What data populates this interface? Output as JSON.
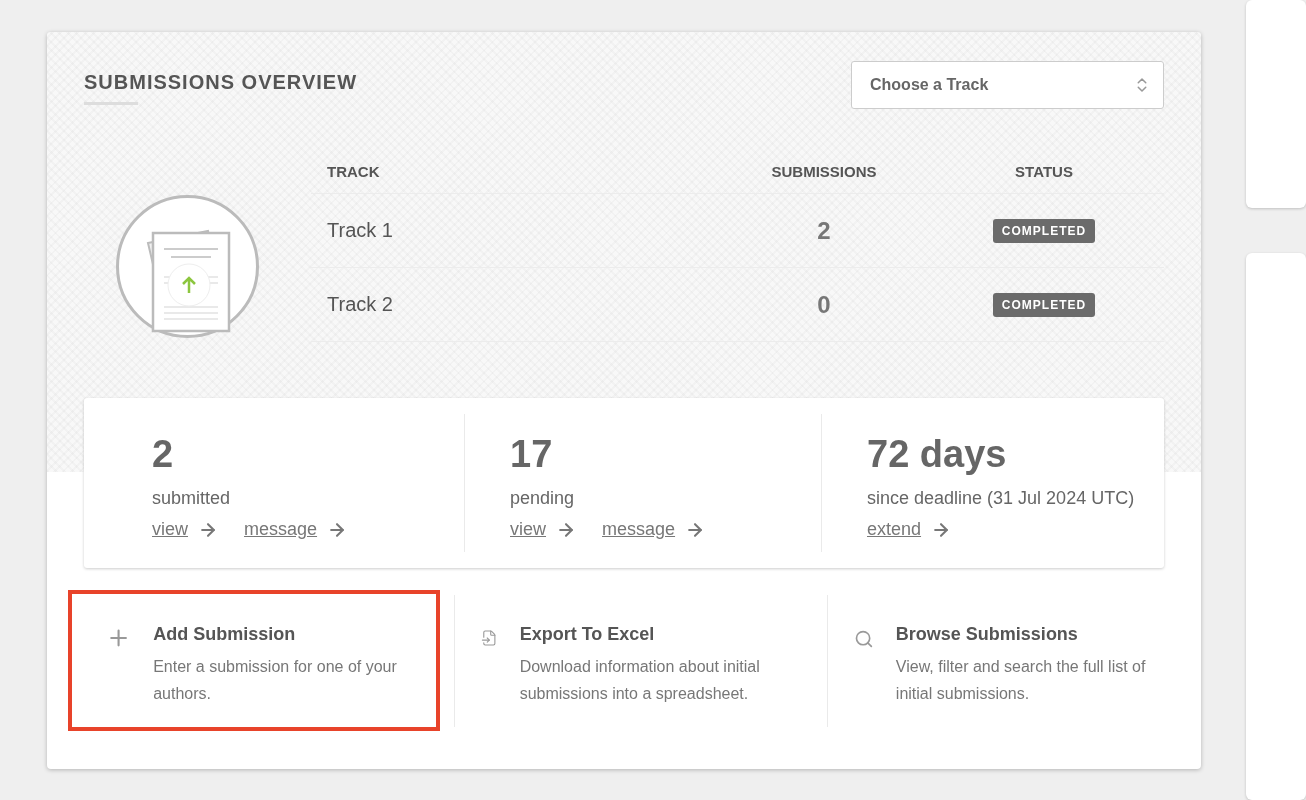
{
  "header": {
    "title": "SUBMISSIONS OVERVIEW",
    "track_select": {
      "value": "Choose a Track"
    }
  },
  "table": {
    "columns": [
      "TRACK",
      "SUBMISSIONS",
      "STATUS"
    ],
    "rows": [
      {
        "track": "Track 1",
        "submissions": "2",
        "status": "COMPLETED"
      },
      {
        "track": "Track 2",
        "submissions": "0",
        "status": "COMPLETED"
      }
    ]
  },
  "stats": [
    {
      "value": "2",
      "label": "submitted",
      "links": [
        "view",
        "message"
      ]
    },
    {
      "value": "17",
      "label": "pending",
      "links": [
        "view",
        "message"
      ]
    },
    {
      "value": "72 days",
      "label": "since deadline (31 Jul 2024 UTC)",
      "links": [
        "extend"
      ]
    }
  ],
  "actions": [
    {
      "kind": "add",
      "title": "Add Submission",
      "description": "Enter a submission for one of your authors.",
      "highlighted": true
    },
    {
      "kind": "export",
      "title": "Export To Excel",
      "description": "Download information about initial submissions into a spreadsheet.",
      "highlighted": false
    },
    {
      "kind": "search",
      "title": "Browse Submissions",
      "description": "View, filter and search the full list of initial submissions.",
      "highlighted": false
    }
  ]
}
